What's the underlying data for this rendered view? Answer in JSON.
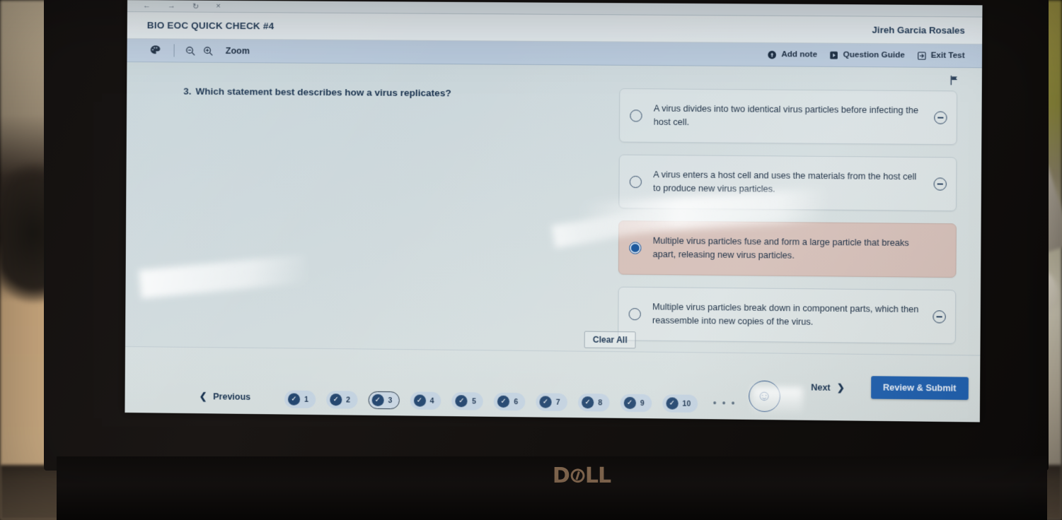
{
  "browser": {
    "nav_icons": [
      "back-arrow",
      "forward-arrow",
      "reload",
      "close"
    ],
    "back": "←",
    "forward": "→",
    "reload": "↻",
    "close": "×"
  },
  "header": {
    "test_title": "BIO EOC QUICK CHECK #4",
    "student_name": "Jireh Garcia Rosales"
  },
  "toolbar": {
    "palette_icon": "◐",
    "zoom_out_icon": "−",
    "zoom_in_icon": "+",
    "zoom_label": "Zoom",
    "add_note_label": "Add note",
    "add_note_icon": "+",
    "question_guide_label": "Question Guide",
    "question_guide_icon": "▸",
    "exit_test_label": "Exit Test",
    "exit_test_icon": "↳"
  },
  "question": {
    "number": "3.",
    "text": "Which statement best describes how a virus replicates?",
    "flag_icon": "⚑",
    "options": [
      {
        "id": "A",
        "text": "A virus divides into two identical virus particles before infecting the host cell.",
        "selected": false,
        "eliminated": false
      },
      {
        "id": "B",
        "text": "A virus enters a host cell and uses the materials from the host cell to produce new virus particles.",
        "selected": false,
        "eliminated": false
      },
      {
        "id": "C",
        "text": "Multiple virus particles fuse and form a large particle that breaks apart, releasing new virus particles.",
        "selected": true,
        "eliminated": false
      },
      {
        "id": "D",
        "text": "Multiple virus particles break down in component parts, which then reassemble into new copies of the virus.",
        "selected": false,
        "eliminated": false
      }
    ],
    "clear_all_label": "Clear All"
  },
  "footer": {
    "previous_label": "Previous",
    "previous_icon": "❮",
    "next_label": "Next",
    "next_icon": "❯",
    "review_submit_label": "Review & Submit",
    "ellipsis": "• • •",
    "smiley_icon": "☺",
    "question_items": [
      {
        "number": "1",
        "answered": true,
        "current": false
      },
      {
        "number": "2",
        "answered": true,
        "current": false
      },
      {
        "number": "3",
        "answered": true,
        "current": true
      },
      {
        "number": "4",
        "answered": true,
        "current": false
      },
      {
        "number": "5",
        "answered": true,
        "current": false
      },
      {
        "number": "6",
        "answered": true,
        "current": false
      },
      {
        "number": "7",
        "answered": true,
        "current": false
      },
      {
        "number": "8",
        "answered": true,
        "current": false
      },
      {
        "number": "9",
        "answered": true,
        "current": false
      },
      {
        "number": "10",
        "answered": true,
        "current": false
      }
    ],
    "check_mark": "✓"
  },
  "device": {
    "brand": "D",
    "brand_o": "⊘",
    "brand_rest": "LL",
    "brand_full": "DELL"
  },
  "colors": {
    "accent_blue": "#2060ae",
    "toolbar_blue": "#b9cadd",
    "selected_option": "#d5bfb8",
    "navy_text": "#17314f",
    "chip_bg": "#c3d2e0"
  }
}
